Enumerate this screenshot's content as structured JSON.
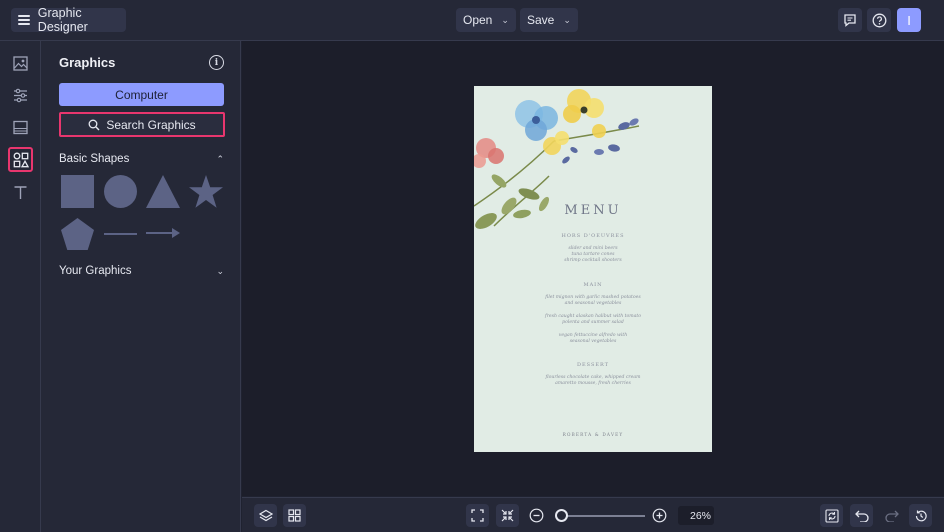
{
  "app": {
    "title": "Graphic Designer"
  },
  "topbar": {
    "open_label": "Open",
    "save_label": "Save",
    "avatar_initial": "I"
  },
  "panel": {
    "title": "Graphics",
    "computer_label": "Computer",
    "search_label": "Search Graphics",
    "basic_shapes_label": "Basic Shapes",
    "your_graphics_label": "Your Graphics"
  },
  "document": {
    "title": "MENU",
    "sections": [
      {
        "heading": "HORS D'OEUVRES",
        "items": [
          "slider and mini beers",
          "tuna tartare cones",
          "shrimp cocktail shooters"
        ]
      },
      {
        "heading": "MAIN",
        "items": [
          "filet mignon with garlic mashed potatoes",
          "and seasonal vegetables",
          "fresh caught alaskan halibut with tomato",
          "polenta and summer salad",
          "vegan fettuccine alfredo with",
          "seasonal vegetables"
        ]
      },
      {
        "heading": "DESSERT",
        "items": [
          "flourless chocolate cake, whipped cream",
          "amaretto mousse, fresh cherries"
        ]
      }
    ],
    "footer": "ROBERTA & DAVEY"
  },
  "bottombar": {
    "zoom_label": "26%",
    "zoom_fraction": 0.05
  },
  "colors": {
    "accent": "#8d9bff",
    "highlight": "#e8366e",
    "shape_fill": "#5c6385",
    "doc_bg": "#e1ece5"
  }
}
